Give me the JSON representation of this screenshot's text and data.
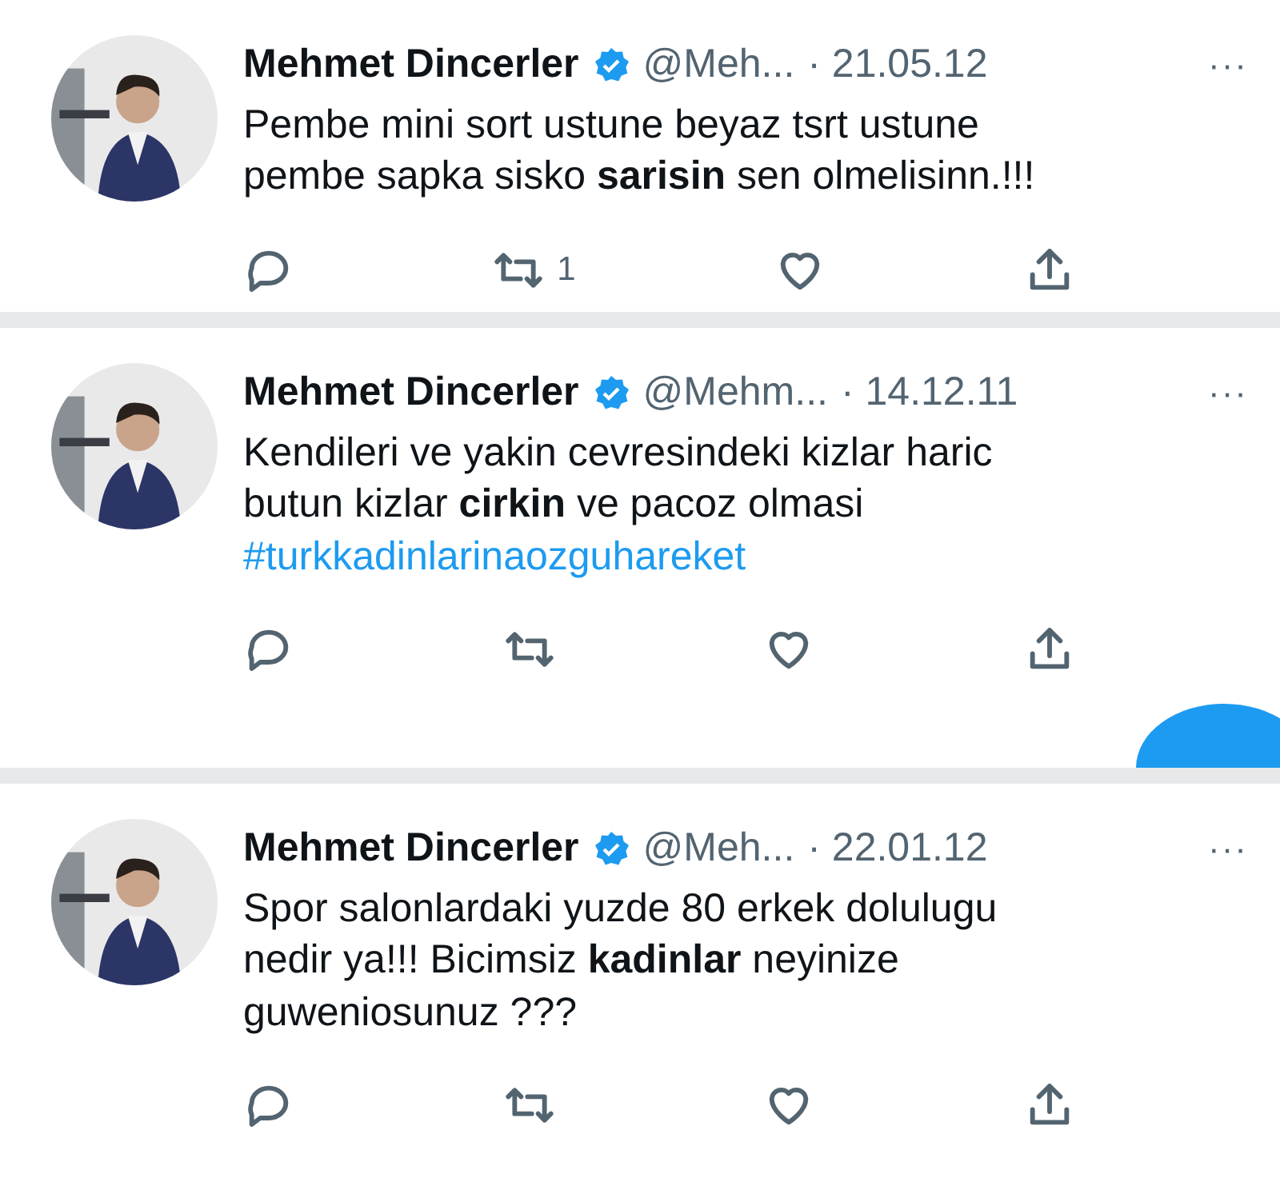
{
  "tweets": [
    {
      "name": "Mehmet Dincerler",
      "verified": true,
      "handle": "@Meh...",
      "date": "· 21.05.12",
      "more": "···",
      "text": "Pembe mini sort ustune beyaz tsrt ustune\npembe sapka sisko **sarisin** sen olmelisinn.!!!",
      "retweet_count": "1"
    },
    {
      "name": "Mehmet Dincerler",
      "verified": true,
      "handle": "@Mehm...",
      "date": "· 14.12.11",
      "more": "···",
      "text": "Kendileri ve yakin cevresindeki kizlar haric\nbutun kizlar **cirkin** ve pacoz olmasi",
      "hashtag": "#turkkadinlarinaozguhareket",
      "fab": true
    },
    {
      "name": "Mehmet Dincerler",
      "verified": true,
      "handle": "@Meh...",
      "date": "· 22.01.12",
      "more": "···",
      "text": "Spor salonlardaki yuzde 80 erkek dolulugu\nnedir ya!!! Bicimsiz **kadinlar** neyinize\nguweniosunuz ???"
    }
  ]
}
